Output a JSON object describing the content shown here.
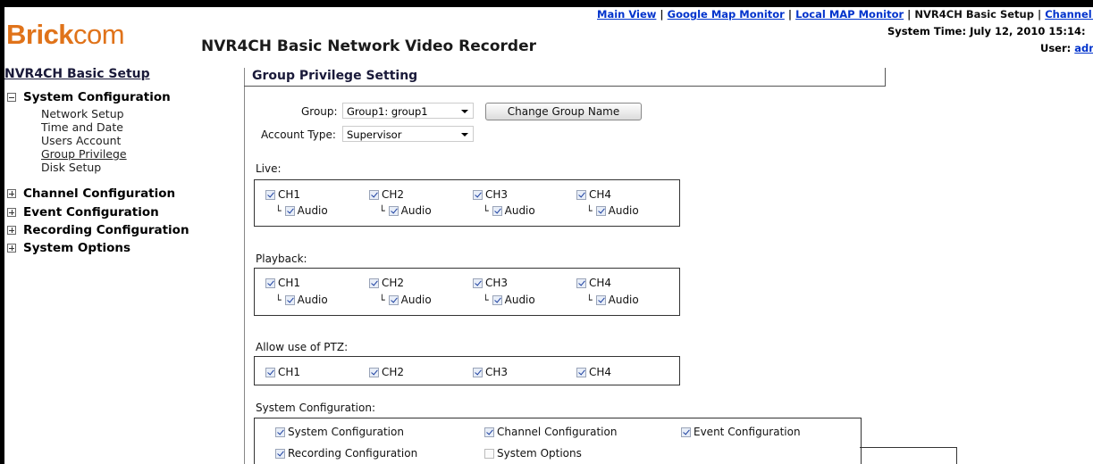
{
  "header": {
    "logo_strong": "Brick",
    "logo_light": "com",
    "title": "NVR4CH Basic Network Video Recorder",
    "nav": [
      {
        "label": "Main View",
        "link": true
      },
      {
        "label": "Google Map Monitor",
        "link": true
      },
      {
        "label": "Local MAP Monitor",
        "link": true
      },
      {
        "label": "NVR4CH Basic Setup",
        "link": false
      },
      {
        "label": "Channel Stat",
        "link": true
      }
    ],
    "system_time": "System Time: July 12, 2010 15:14:",
    "user_label": "User:",
    "user_name": "adm"
  },
  "sidebar": {
    "title": "NVR4CH Basic Setup",
    "sections": [
      {
        "label": "System Configuration",
        "expanded": true,
        "items": [
          "Network Setup",
          "Time and Date",
          "Users Account",
          "Group Privilege",
          "Disk Setup"
        ],
        "active": "Group Privilege"
      },
      {
        "label": "Channel Configuration",
        "expanded": false
      },
      {
        "label": "Event Configuration",
        "expanded": false
      },
      {
        "label": "Recording Configuration",
        "expanded": false
      },
      {
        "label": "System Options",
        "expanded": false
      }
    ]
  },
  "main": {
    "title": "Group Privilege Setting",
    "group_label": "Group:",
    "group_value": "Group1: group1",
    "change_button": "Change Group Name",
    "account_label": "Account Type:",
    "account_value": "Supervisor",
    "live": {
      "label": "Live:",
      "channels": [
        "CH1",
        "CH2",
        "CH3",
        "CH4"
      ],
      "audio_label": "Audio"
    },
    "playback": {
      "label": "Playback:",
      "channels": [
        "CH1",
        "CH2",
        "CH3",
        "CH4"
      ],
      "audio_label": "Audio"
    },
    "ptz": {
      "label": "Allow use of PTZ:",
      "channels": [
        "CH1",
        "CH2",
        "CH3",
        "CH4"
      ]
    },
    "system": {
      "label": "System Configuration:",
      "options": [
        {
          "label": "System Configuration",
          "checked": true
        },
        {
          "label": "Channel Configuration",
          "checked": true
        },
        {
          "label": "Event Configuration",
          "checked": true
        },
        {
          "label": "Recording Configuration",
          "checked": true
        },
        {
          "label": "System Options",
          "checked": false
        }
      ]
    }
  },
  "colors": {
    "brand": "#e0731a",
    "link": "#0033cc",
    "check": "#1b3fa0"
  }
}
